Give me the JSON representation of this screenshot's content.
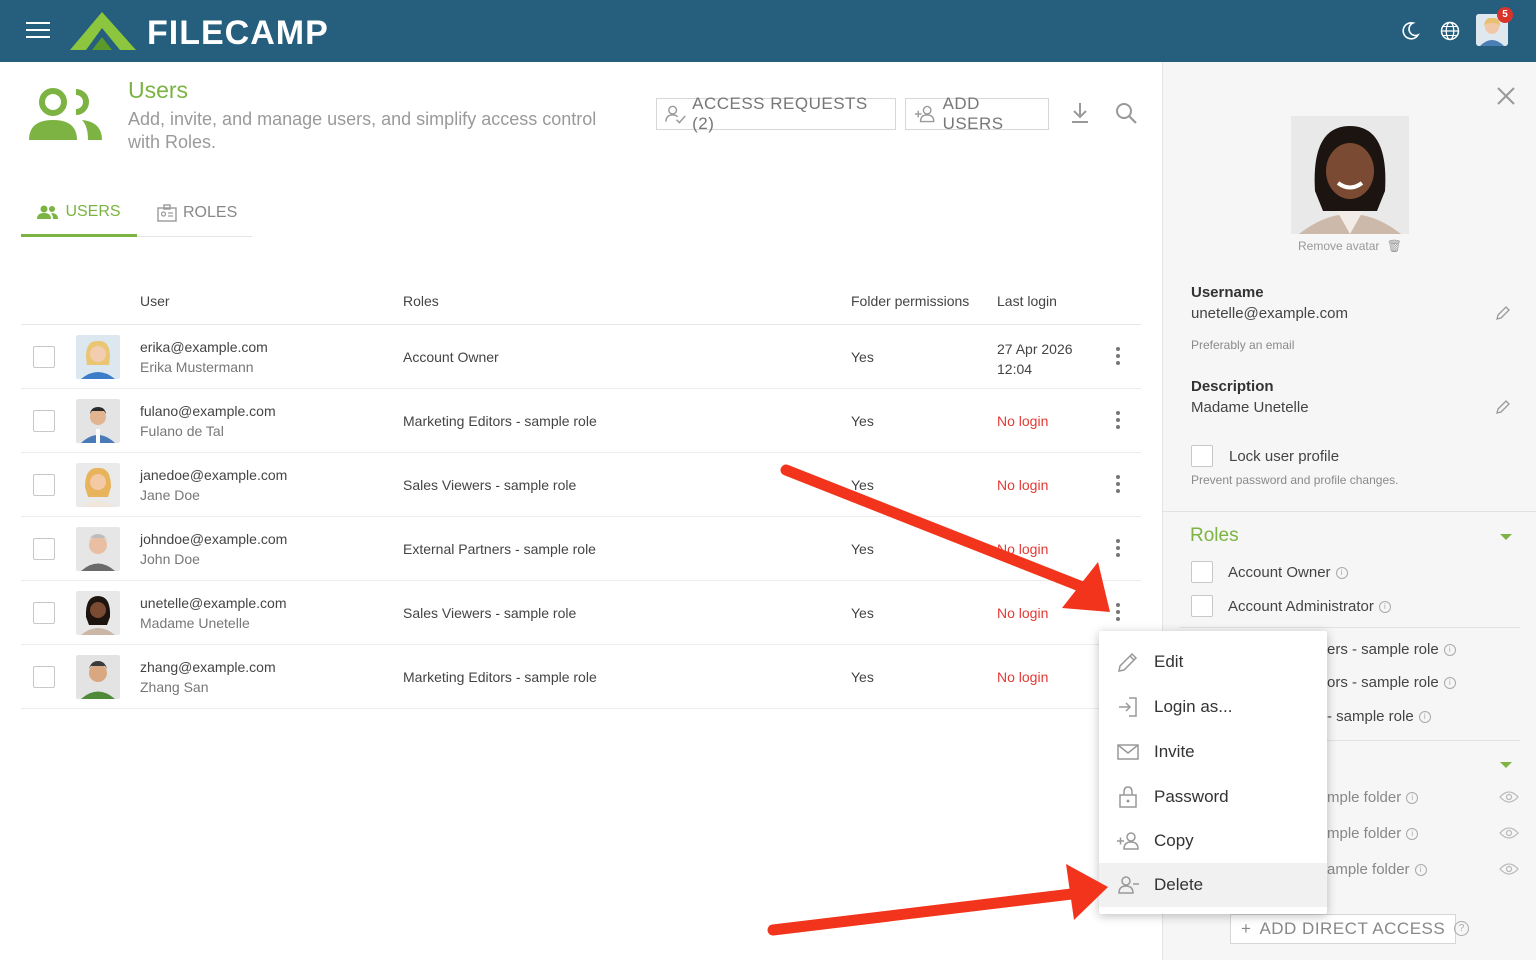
{
  "app": {
    "name": "FILECAMP",
    "notification_count": "5"
  },
  "page": {
    "title": "Users",
    "subtitle": "Add, invite, and manage users, and simplify access control with Roles."
  },
  "toolbar": {
    "access_requests_label": "ACCESS REQUESTS (2)",
    "add_users_label": "ADD USERS"
  },
  "tabs": [
    {
      "label": "USERS",
      "active": true
    },
    {
      "label": "ROLES",
      "active": false
    }
  ],
  "table": {
    "columns": [
      "User",
      "Roles",
      "Folder permissions",
      "Last login"
    ],
    "rows": [
      {
        "email": "erika@example.com",
        "name": "Erika Mustermann",
        "role": "Account Owner",
        "folder_permissions": "Yes",
        "last_login": "27 Apr 2026",
        "last_login_time": "12:04"
      },
      {
        "email": "fulano@example.com",
        "name": "Fulano de Tal",
        "role": "Marketing Editors - sample role",
        "folder_permissions": "Yes",
        "last_login": "No login"
      },
      {
        "email": "janedoe@example.com",
        "name": "Jane Doe",
        "role": "Sales Viewers - sample role",
        "folder_permissions": "Yes",
        "last_login": "No login"
      },
      {
        "email": "johndoe@example.com",
        "name": "John Doe",
        "role": "External Partners - sample role",
        "folder_permissions": "Yes",
        "last_login": "No login"
      },
      {
        "email": "unetelle@example.com",
        "name": "Madame Unetelle",
        "role": "Sales Viewers - sample role",
        "folder_permissions": "Yes",
        "last_login": "No login"
      },
      {
        "email": "zhang@example.com",
        "name": "Zhang San",
        "role": "Marketing Editors - sample role",
        "folder_permissions": "Yes",
        "last_login": "No login"
      }
    ]
  },
  "context_menu": {
    "items": [
      "Edit",
      "Login as...",
      "Invite",
      "Password",
      "Copy",
      "Delete"
    ]
  },
  "panel": {
    "remove_avatar_label": "Remove avatar",
    "username_label": "Username",
    "username_value": "unetelle@example.com",
    "username_hint": "Preferably an email",
    "description_label": "Description",
    "description_value": "Madame Unetelle",
    "lock_label": "Lock user profile",
    "lock_hint": "Prevent password and profile changes.",
    "roles_title": "Roles",
    "roles": [
      "Account Owner",
      "Account Administrator"
    ],
    "role_fragments": [
      "ers - sample role",
      "ors - sample role",
      "- sample role"
    ],
    "folder_fragments": [
      "mple folder",
      "mple folder",
      "ample folder"
    ],
    "add_direct_access_label": "ADD DIRECT ACCESS"
  },
  "colors": {
    "header": "#255f7d",
    "accent": "#7cb342",
    "no_login": "#e53935",
    "arrow": "#f2341c"
  }
}
